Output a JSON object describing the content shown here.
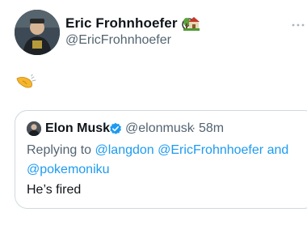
{
  "author": {
    "name": "Eric Frohnhoefer @",
    "handle": "@EricFrohnhoefer",
    "house_icon": "house-with-garden-icon"
  },
  "tweet": {
    "emoji_icon": "saluting-hand-emoji"
  },
  "more_icon": "more-horizontal-icon",
  "quote": {
    "author_name": "Elon Musk",
    "verified_icon": "verified-badge-icon",
    "handle": "@elonmusk",
    "separator": "·",
    "time": "58m",
    "replying_prefix": "Replying to",
    "mentions": [
      "@langdon",
      "@EricFrohnhoefer",
      "@pokemoniku"
    ],
    "and_word": "and",
    "text": "He’s fired"
  },
  "colors": {
    "link": "#1d9bf0",
    "secondary_text": "#536471",
    "border": "#cfd9de"
  }
}
